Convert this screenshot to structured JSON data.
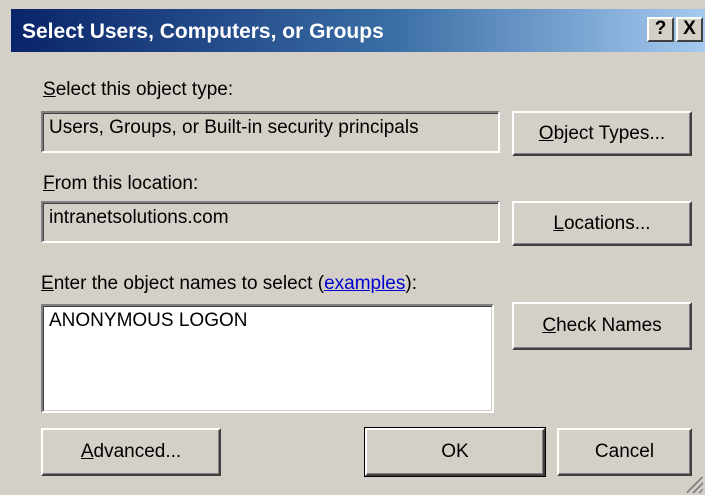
{
  "window": {
    "title": "Select Users, Computers, or Groups",
    "help_glyph": "?",
    "close_glyph": "X"
  },
  "object_type": {
    "label_access": "S",
    "label_rest": "elect this object type:",
    "value": "Users, Groups, or Built-in security principals",
    "button_access": "O",
    "button_rest": "bject Types..."
  },
  "location": {
    "label_access": "F",
    "label_rest": "rom this location:",
    "value": "intranetsolutions.com",
    "button_access": "L",
    "button_rest": "ocations..."
  },
  "names": {
    "label_access": "E",
    "label_rest": "nter the object names to select (",
    "link": "examples",
    "label_end": "):",
    "value": "ANONYMOUS LOGON",
    "check_access": "C",
    "check_rest": "heck Names"
  },
  "footer": {
    "advanced_access": "A",
    "advanced_rest": "dvanced...",
    "ok": "OK",
    "cancel": "Cancel"
  }
}
